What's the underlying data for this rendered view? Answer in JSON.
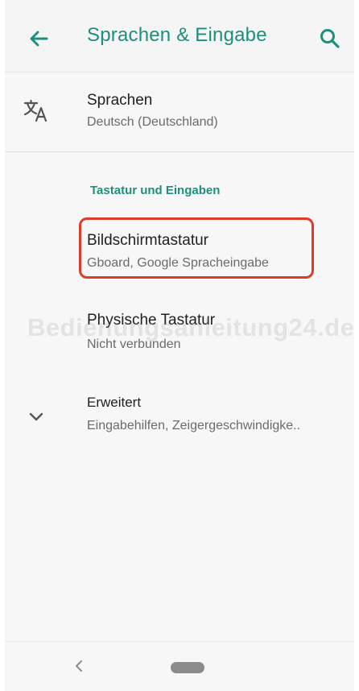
{
  "app_bar": {
    "title": "Sprachen & Eingabe",
    "back_icon": "arrow-left-icon",
    "search_icon": "search-icon"
  },
  "languages": {
    "icon": "translate-icon",
    "title": "Sprachen",
    "subtitle": "Deutsch (Deutschland)"
  },
  "section": {
    "header": "Tastatur und Eingaben"
  },
  "items": [
    {
      "title": "Bildschirmtastatur",
      "subtitle": "Gboard, Google Spracheingabe",
      "highlighted": true
    },
    {
      "title": "Physische Tastatur",
      "subtitle": "Nicht verbunden",
      "highlighted": false
    }
  ],
  "advanced": {
    "icon": "chevron-down-icon",
    "title": "Erweitert",
    "subtitle": "Eingabehilfen, Zeigergeschwindigke.."
  },
  "watermark": "Bedienungsanleitung24.de",
  "nav_bar": {
    "back_icon": "nav-back-icon",
    "home_icon": "home-pill-icon"
  },
  "colors": {
    "accent": "#1d8f7c",
    "highlight_border": "#e03a2a",
    "background": "#f7f7f7"
  }
}
